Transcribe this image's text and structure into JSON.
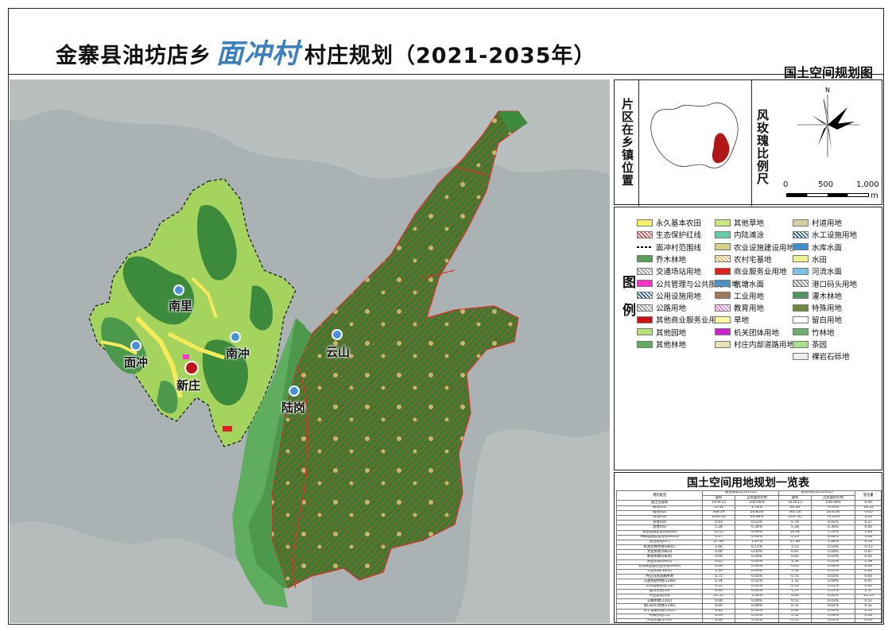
{
  "header": {
    "title_prefix": "金寨县油坊店乡",
    "village_name": "面冲村",
    "title_suffix": "村庄规划（2021-2035年）",
    "subtitle": "国土空间规划图"
  },
  "location_panel": {
    "label": "片区在乡镇位置",
    "compass_label": "风玫瑰比例尺",
    "north": "N",
    "scale_ticks": [
      "0",
      "500",
      "1,000"
    ],
    "scale_unit": "m"
  },
  "map": {
    "places": [
      {
        "name": "南里"
      },
      {
        "name": "南冲"
      },
      {
        "name": "面冲"
      },
      {
        "name": "新庄"
      },
      {
        "name": "云山"
      },
      {
        "name": "陆岗"
      }
    ],
    "colors": {
      "water": "#aab2b3",
      "forest": "#3c8a3c",
      "village_base": "#a4d35e",
      "red_line": "#e03030",
      "crop": "#f5ea5a"
    }
  },
  "legend": {
    "title": "图例",
    "items": [
      {
        "label": "永久基本农田",
        "swatch": "#f5f26a",
        "pattern": "solid"
      },
      {
        "label": "其他草地",
        "swatch": "#c9e882",
        "pattern": "solid"
      },
      {
        "label": "村道用地",
        "swatch": "#d8cfa0",
        "pattern": "solid"
      },
      {
        "label": "生态保护红线",
        "swatch": "#e04040",
        "pattern": "hatch-red"
      },
      {
        "label": "内陆滩涂",
        "swatch": "#66cdaa",
        "pattern": "solid"
      },
      {
        "label": "水工设施用地",
        "swatch": "#1f5a8a",
        "pattern": "hatch"
      },
      {
        "label": "面冲村范围线",
        "swatch": "#000000",
        "pattern": "dash"
      },
      {
        "label": "农业设施建设用地",
        "swatch": "#d4d08a",
        "pattern": "solid"
      },
      {
        "label": "水库水面",
        "swatch": "#3c8fd0",
        "pattern": "solid"
      },
      {
        "label": "乔木林地",
        "swatch": "#5aa05a",
        "pattern": "solid"
      },
      {
        "label": "农村宅基地",
        "swatch": "#e8b060",
        "pattern": "hatch-orange"
      },
      {
        "label": "水田",
        "swatch": "#eef28c",
        "pattern": "solid"
      },
      {
        "label": "交通场站用地",
        "swatch": "#999999",
        "pattern": "hatch-gray"
      },
      {
        "label": "商业服务业用地",
        "swatch": "#e02020",
        "pattern": "solid"
      },
      {
        "label": "河流水面",
        "swatch": "#7fc0e8",
        "pattern": "solid"
      },
      {
        "label": "公共管理与公共服务用地",
        "swatch": "#ff33cc",
        "pattern": "solid"
      },
      {
        "label": "坑塘水面",
        "swatch": "#4a90c0",
        "pattern": "solid"
      },
      {
        "label": "港口码头用地",
        "swatch": "#888888",
        "pattern": "hatch-gray"
      },
      {
        "label": "公用设施用地",
        "swatch": "#1f5a8a",
        "pattern": "hatch"
      },
      {
        "label": "工业用地",
        "swatch": "#a0785a",
        "pattern": "solid"
      },
      {
        "label": "灌木林地",
        "swatch": "#4e9a5e",
        "pattern": "solid"
      },
      {
        "label": "公路用地",
        "swatch": "#999999",
        "pattern": "hatch-gray"
      },
      {
        "label": "教育用地",
        "swatch": "#e080d0",
        "pattern": "hatch-pink"
      },
      {
        "label": "特殊用地",
        "swatch": "#6e8a3a",
        "pattern": "solid"
      },
      {
        "label": "其他商业服务业用地",
        "swatch": "#d01010",
        "pattern": "solid"
      },
      {
        "label": "旱地",
        "swatch": "#fffaa0",
        "pattern": "solid"
      },
      {
        "label": "留白用地",
        "swatch": "#ffffff",
        "pattern": "solid"
      },
      {
        "label": "其他园地",
        "swatch": "#b8e07a",
        "pattern": "solid"
      },
      {
        "label": "机关团体用地",
        "swatch": "#cc22cc",
        "pattern": "solid"
      },
      {
        "label": "竹林地",
        "swatch": "#6bb06b",
        "pattern": "solid"
      },
      {
        "label": "其他林地",
        "swatch": "#5fae5f",
        "pattern": "solid"
      },
      {
        "label": "村庄内部道路用地",
        "swatch": "#e8e0b8",
        "pattern": "solid"
      },
      {
        "label": "茶园",
        "swatch": "#a8e08a",
        "pattern": "solid"
      },
      {
        "label": "",
        "swatch": "#ffffff",
        "pattern": "none"
      },
      {
        "label": "",
        "swatch": "#ffffff",
        "pattern": "none"
      },
      {
        "label": "裸岩石砾地",
        "swatch": "#eeeeee",
        "pattern": "solid"
      }
    ]
  },
  "table": {
    "title": "国土空间用地规划一览表",
    "headers": {
      "c1": "规划类型",
      "base": "规划基期年(2021年)",
      "target": "规划目标年(2035年)",
      "area": "面积",
      "share": "占总面积比例",
      "change": "变化量"
    },
    "rows": [
      {
        "name": "国土总面积",
        "a1": "1478.13",
        "p1": "100.00%",
        "a2": "1478.13",
        "p2": "100.00%",
        "d": "0.00"
      },
      {
        "name": "耕地(01)",
        "a1": "55.92",
        "p1": "3.78%",
        "a2": "66.46",
        "p2": "4.49%",
        "d": "10.52"
      },
      {
        "name": "园地(02)",
        "a1": "308.19",
        "p1": "20.85%",
        "a2": "305.14",
        "p2": "20.65%",
        "d": "-3.05"
      },
      {
        "name": "林地(03)",
        "a1": "1034.43",
        "p1": "69.98%",
        "a2": "1037.65",
        "p2": "70.20%",
        "d": "3.22"
      },
      {
        "name": "草地(04)",
        "a1": "0.43",
        "p1": "0.03%",
        "a2": "0.70",
        "p2": "0.05%",
        "d": "0.27"
      },
      {
        "name": "湿地(05)",
        "a1": "5.28",
        "p1": "0.36%",
        "a2": "5.28",
        "p2": "0.36%",
        "d": "0.00"
      },
      {
        "name": "农业设施建设用地(06)",
        "a1": "13.25",
        "p1": "0.90%",
        "a2": "16.92",
        "p2": "1.14%",
        "d": "3.66"
      },
      {
        "name": "种植设施建设用地(0603)",
        "a1": "0.17",
        "p1": "0.01%",
        "a2": "0.23",
        "p2": "0.02%",
        "d": "0.06"
      },
      {
        "name": "居住用地(07)",
        "a1": "27.60",
        "p1": "1.87%",
        "a2": "27.46",
        "p2": "1.86%",
        "d": "-0.14"
      },
      {
        "name": "机关团体用地(0801)",
        "a1": "1.66",
        "p1": "0.11%",
        "a2": "1.51",
        "p2": "0.10%",
        "d": "-0.15"
      },
      {
        "name": "文化用地(0803)",
        "a1": "0.00",
        "p1": "0.00%",
        "a2": "0.87",
        "p2": "0.06%",
        "d": "0.87"
      },
      {
        "name": "教育用地(0804)",
        "a1": "0.00",
        "p1": "0.00%",
        "a2": "0.45",
        "p2": "0.03%",
        "d": "0.45"
      },
      {
        "name": "商业用地(0901)",
        "a1": "0.05",
        "p1": "0.00%",
        "a2": "1.54",
        "p2": "0.10%",
        "d": "1.48"
      },
      {
        "name": "其他商业服务业用地(0904)",
        "a1": "0.00",
        "p1": "0.00%",
        "a2": "0.03",
        "p2": "0.00%",
        "d": "0.03"
      },
      {
        "name": "工业用地(1001)",
        "a1": "1.29",
        "p1": "0.09%",
        "a2": "1.54",
        "p2": "0.11%",
        "d": "0.26"
      },
      {
        "name": "村庄内部道路用地",
        "a1": "0.75",
        "p1": "0.05%",
        "a2": "0.75",
        "p2": "0.05%",
        "d": "0.00"
      },
      {
        "name": "交通场站用地(1208)",
        "a1": "0.34",
        "p1": "0.02%",
        "a2": "1.31",
        "p2": "0.09%",
        "d": "0.97"
      },
      {
        "name": "公用设施用地(13)",
        "a1": "0.12",
        "p1": "0.01%",
        "a2": "0.12",
        "p2": "0.01%",
        "d": "0.00"
      },
      {
        "name": "留白用地(16)",
        "a1": "0.00",
        "p1": "0.00%",
        "a2": "1.57",
        "p2": "0.11%",
        "d": "1.57"
      },
      {
        "name": "村庄建设用地",
        "a1": "21.55",
        "p1": "1.46%",
        "a2": "0.00",
        "p2": "0.00%",
        "d": "-21.55"
      },
      {
        "name": "公路用地(1202)",
        "a1": "0.00",
        "p1": "0.00%",
        "a2": "0.51",
        "p2": "0.03%",
        "d": "0.51"
      },
      {
        "name": "港口码头用地(1206)",
        "a1": "0.00",
        "p1": "0.00%",
        "a2": "0.31",
        "p2": "0.02%",
        "d": "0.31"
      },
      {
        "name": "水工设施用地(1312)",
        "a1": "0.82",
        "p1": "0.06%",
        "a2": "0.92",
        "p2": "0.06%",
        "d": "0.10"
      },
      {
        "name": "特殊用地(15)",
        "a1": "0.49",
        "p1": "0.03%",
        "a2": "0.52",
        "p2": "0.04%",
        "d": "0.03"
      },
      {
        "name": "河流水面(1701)",
        "a1": "0.16",
        "p1": "0.01%",
        "a2": "0.15",
        "p2": "0.01%",
        "d": "-0.01"
      },
      {
        "name": "水库水面(1703)",
        "a1": "4.70",
        "p1": "0.32%",
        "a2": "4.71",
        "p2": "0.32%",
        "d": "0.01"
      },
      {
        "name": "坑塘水面(1704)",
        "a1": "0.94",
        "p1": "0.06%",
        "a2": "1.35",
        "p2": "0.09%",
        "d": "0.41"
      },
      {
        "name": "其他土地(23)",
        "a1": "0.00",
        "p1": "0.00%",
        "a2": "0.09",
        "p2": "0.01%",
        "d": "0.09"
      },
      {
        "name": "总计",
        "a1": "1478.13",
        "p1": "100.00%",
        "a2": "1478.13",
        "p2": "100.00%",
        "d": "0.00"
      }
    ]
  }
}
